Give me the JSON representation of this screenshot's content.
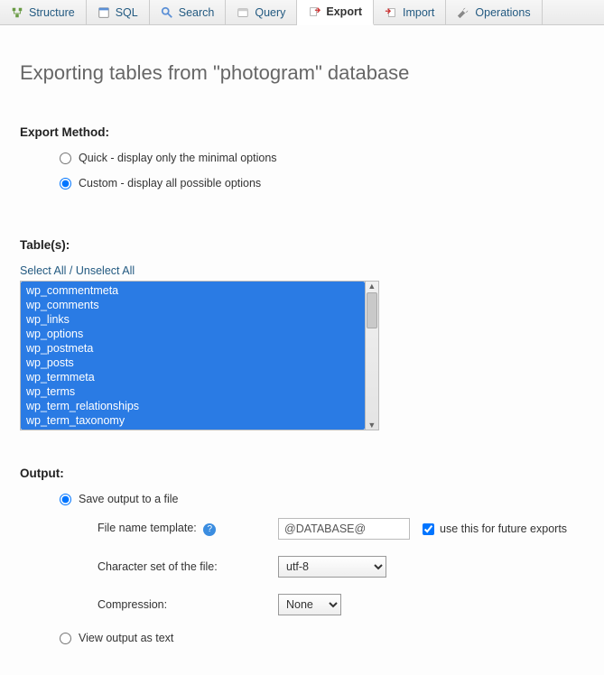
{
  "tabs": {
    "structure": "Structure",
    "sql": "SQL",
    "search": "Search",
    "query": "Query",
    "export": "Export",
    "import": "Import",
    "operations": "Operations"
  },
  "title": "Exporting tables from \"photogram\" database",
  "export_method": {
    "heading": "Export Method:",
    "quick_label": "Quick - display only the minimal options",
    "custom_label": "Custom - display all possible options"
  },
  "tables": {
    "heading": "Table(s):",
    "select_all": "Select All",
    "unselect_all": "Unselect All",
    "items": [
      "wp_commentmeta",
      "wp_comments",
      "wp_links",
      "wp_options",
      "wp_postmeta",
      "wp_posts",
      "wp_termmeta",
      "wp_terms",
      "wp_term_relationships",
      "wp_term_taxonomy"
    ]
  },
  "output": {
    "heading": "Output:",
    "save_label": "Save output to a file",
    "filename_label": "File name template:",
    "filename_value": "@DATABASE@",
    "future_label": "use this for future exports",
    "charset_label": "Character set of the file:",
    "charset_value": "utf-8",
    "compression_label": "Compression:",
    "compression_value": "None",
    "view_text_label": "View output as text"
  }
}
